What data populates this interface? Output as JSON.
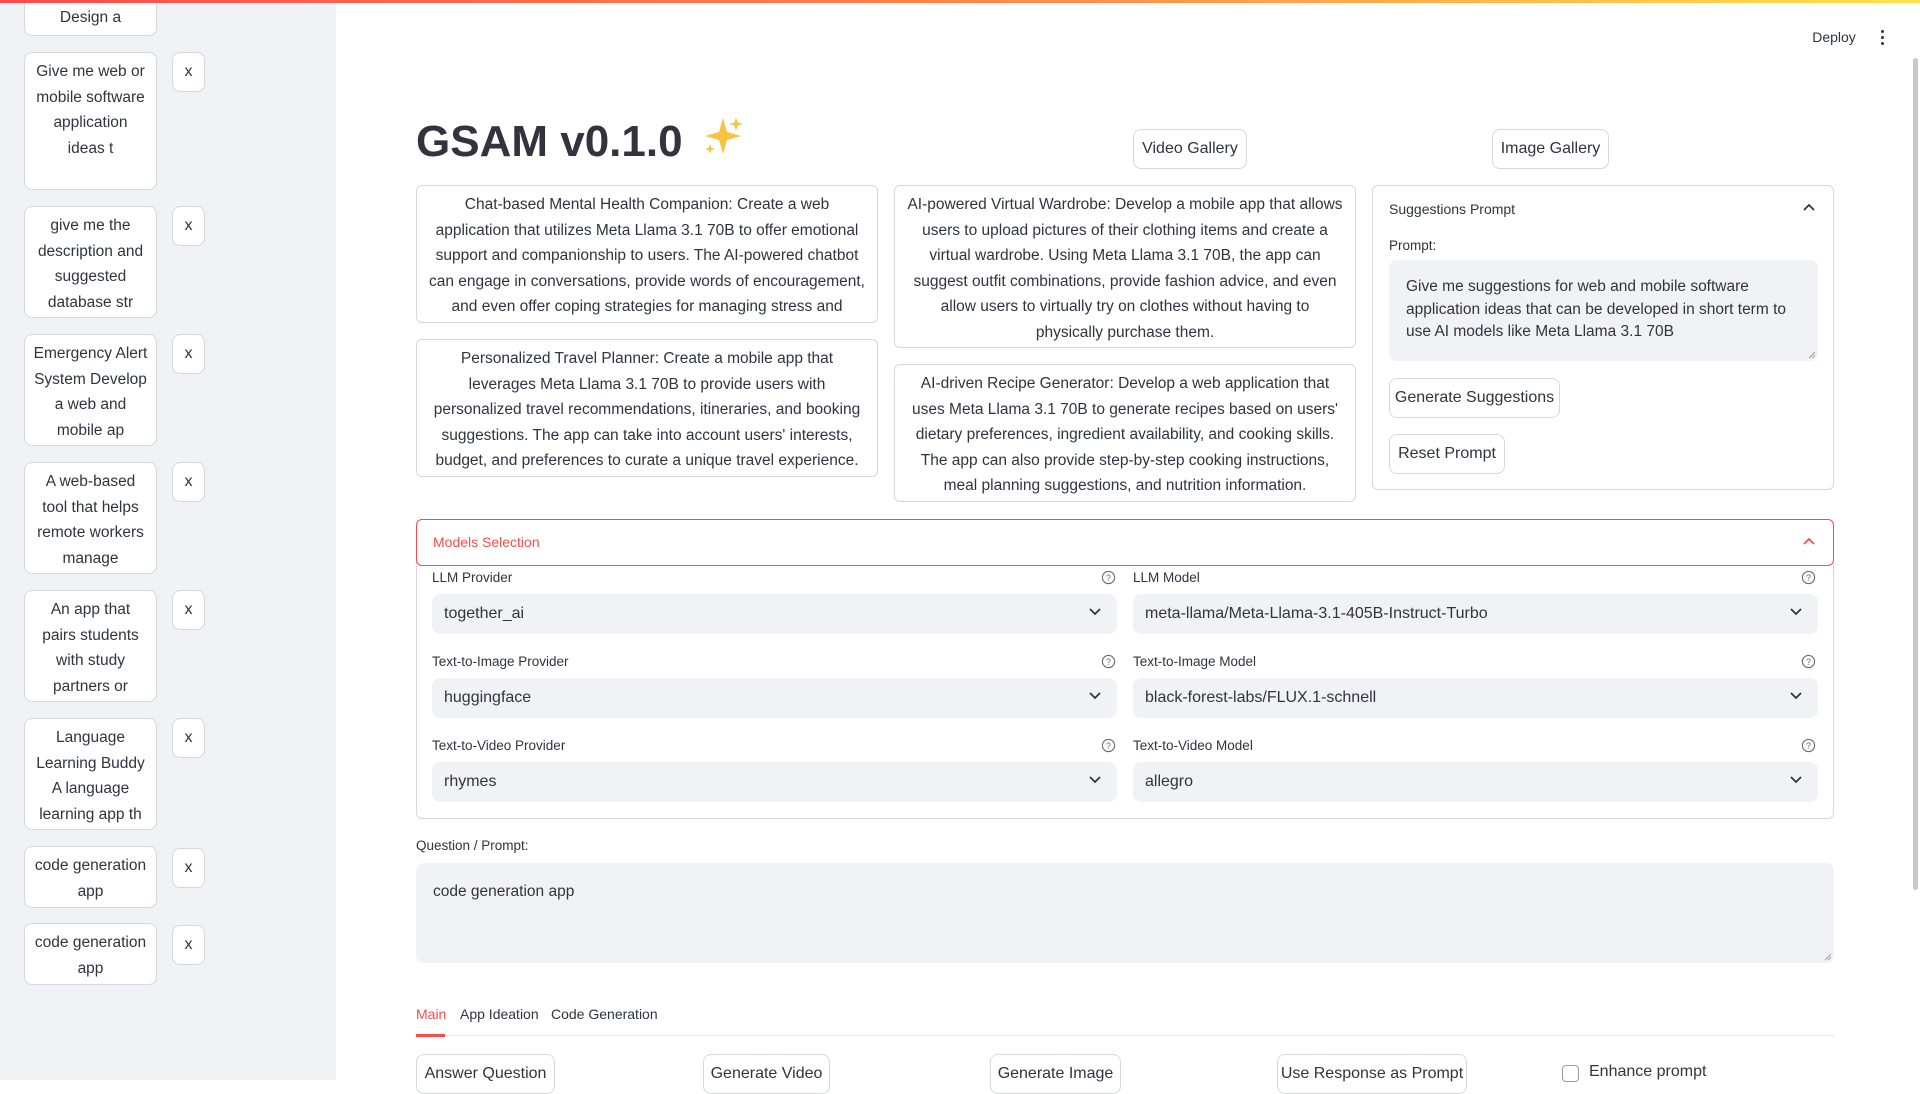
{
  "history": [
    {
      "label": "Design a",
      "close_label": ""
    },
    {
      "label": "Give me web or mobile software application ideas t",
      "close_label": "x"
    },
    {
      "label": "give me the description and suggested database str",
      "close_label": "x"
    },
    {
      "label": "Emergency Alert System Develop a web and mobile ap",
      "close_label": "x"
    },
    {
      "label": "A web-based tool that helps remote workers manage",
      "close_label": "x"
    },
    {
      "label": "An app that pairs students with study partners or",
      "close_label": "x"
    },
    {
      "label": "Language Learning Buddy A language learning app th",
      "close_label": "x"
    },
    {
      "label": "code generation app",
      "close_label": "x"
    },
    {
      "label": "code generation app",
      "close_label": "x"
    }
  ],
  "header": {
    "deploy_label": "Deploy",
    "menu_icon": "kebab-menu-icon"
  },
  "title": {
    "text": "GSAM v0.1.0",
    "icon": "sparkles-icon"
  },
  "gallery": {
    "video_label": "Video Gallery",
    "image_label": "Image Gallery"
  },
  "suggestions": [
    "Chat-based Mental Health Companion: Create a web application that utilizes Meta Llama 3.1 70B to offer emotional support and companionship to users. The AI-powered chatbot can engage in conversations, provide words of encouragement, and even offer coping strategies for managing stress and anxiety.",
    "Personalized Travel Planner: Create a mobile app that leverages Meta Llama 3.1 70B to provide users with personalized travel recommendations, itineraries, and booking suggestions. The app can take into account users' interests, budget, and preferences to curate a unique travel experience.",
    "AI-powered Virtual Wardrobe: Develop a mobile app that allows users to upload pictures of their clothing items and create a virtual wardrobe. Using Meta Llama 3.1 70B, the app can suggest outfit combinations, provide fashion advice, and even allow users to virtually try on clothes without having to physically purchase them.",
    "AI-driven Recipe Generator: Develop a web application that uses Meta Llama 3.1 70B to generate recipes based on users' dietary preferences, ingredient availability, and cooking skills. The app can also provide step-by-step cooking instructions, meal planning suggestions, and nutrition information."
  ],
  "suggestions_prompt": {
    "header": "Suggestions Prompt",
    "prompt_label": "Prompt:",
    "prompt_value": "Give me suggestions for web and mobile software application ideas that can be developed in short term  to use AI models like Meta Llama 3.1 70B",
    "generate_label": "Generate Suggestions",
    "reset_label": "Reset Prompt"
  },
  "models": {
    "header": "Models Selection",
    "llm_provider_label": "LLM Provider",
    "llm_provider_value": "together_ai",
    "llm_model_label": "LLM Model",
    "llm_model_value": "meta-llama/Meta-Llama-3.1-405B-Instruct-Turbo",
    "t2i_provider_label": "Text-to-Image Provider",
    "t2i_provider_value": "huggingface",
    "t2i_model_label": "Text-to-Image Model",
    "t2i_model_value": "black-forest-labs/FLUX.1-schnell",
    "t2v_provider_label": "Text-to-Video Provider",
    "t2v_provider_value": "rhymes",
    "t2v_model_label": "Text-to-Video Model",
    "t2v_model_value": "allegro"
  },
  "question": {
    "label": "Question / Prompt:",
    "value": "code generation app"
  },
  "tabs": [
    {
      "label": "Main",
      "active": true
    },
    {
      "label": "App Ideation",
      "active": false
    },
    {
      "label": "Code Generation",
      "active": false
    }
  ],
  "actions": {
    "answer_label": "Answer Question",
    "video_label": "Generate Video",
    "image_label": "Generate Image",
    "use_response_label": "Use Response as Prompt",
    "enhance_label": "Enhance prompt"
  },
  "colors": {
    "accent": "#ff4b4b",
    "sidebar_bg": "#f0f2f6",
    "text": "#31333f",
    "border": "#d6d8de"
  }
}
